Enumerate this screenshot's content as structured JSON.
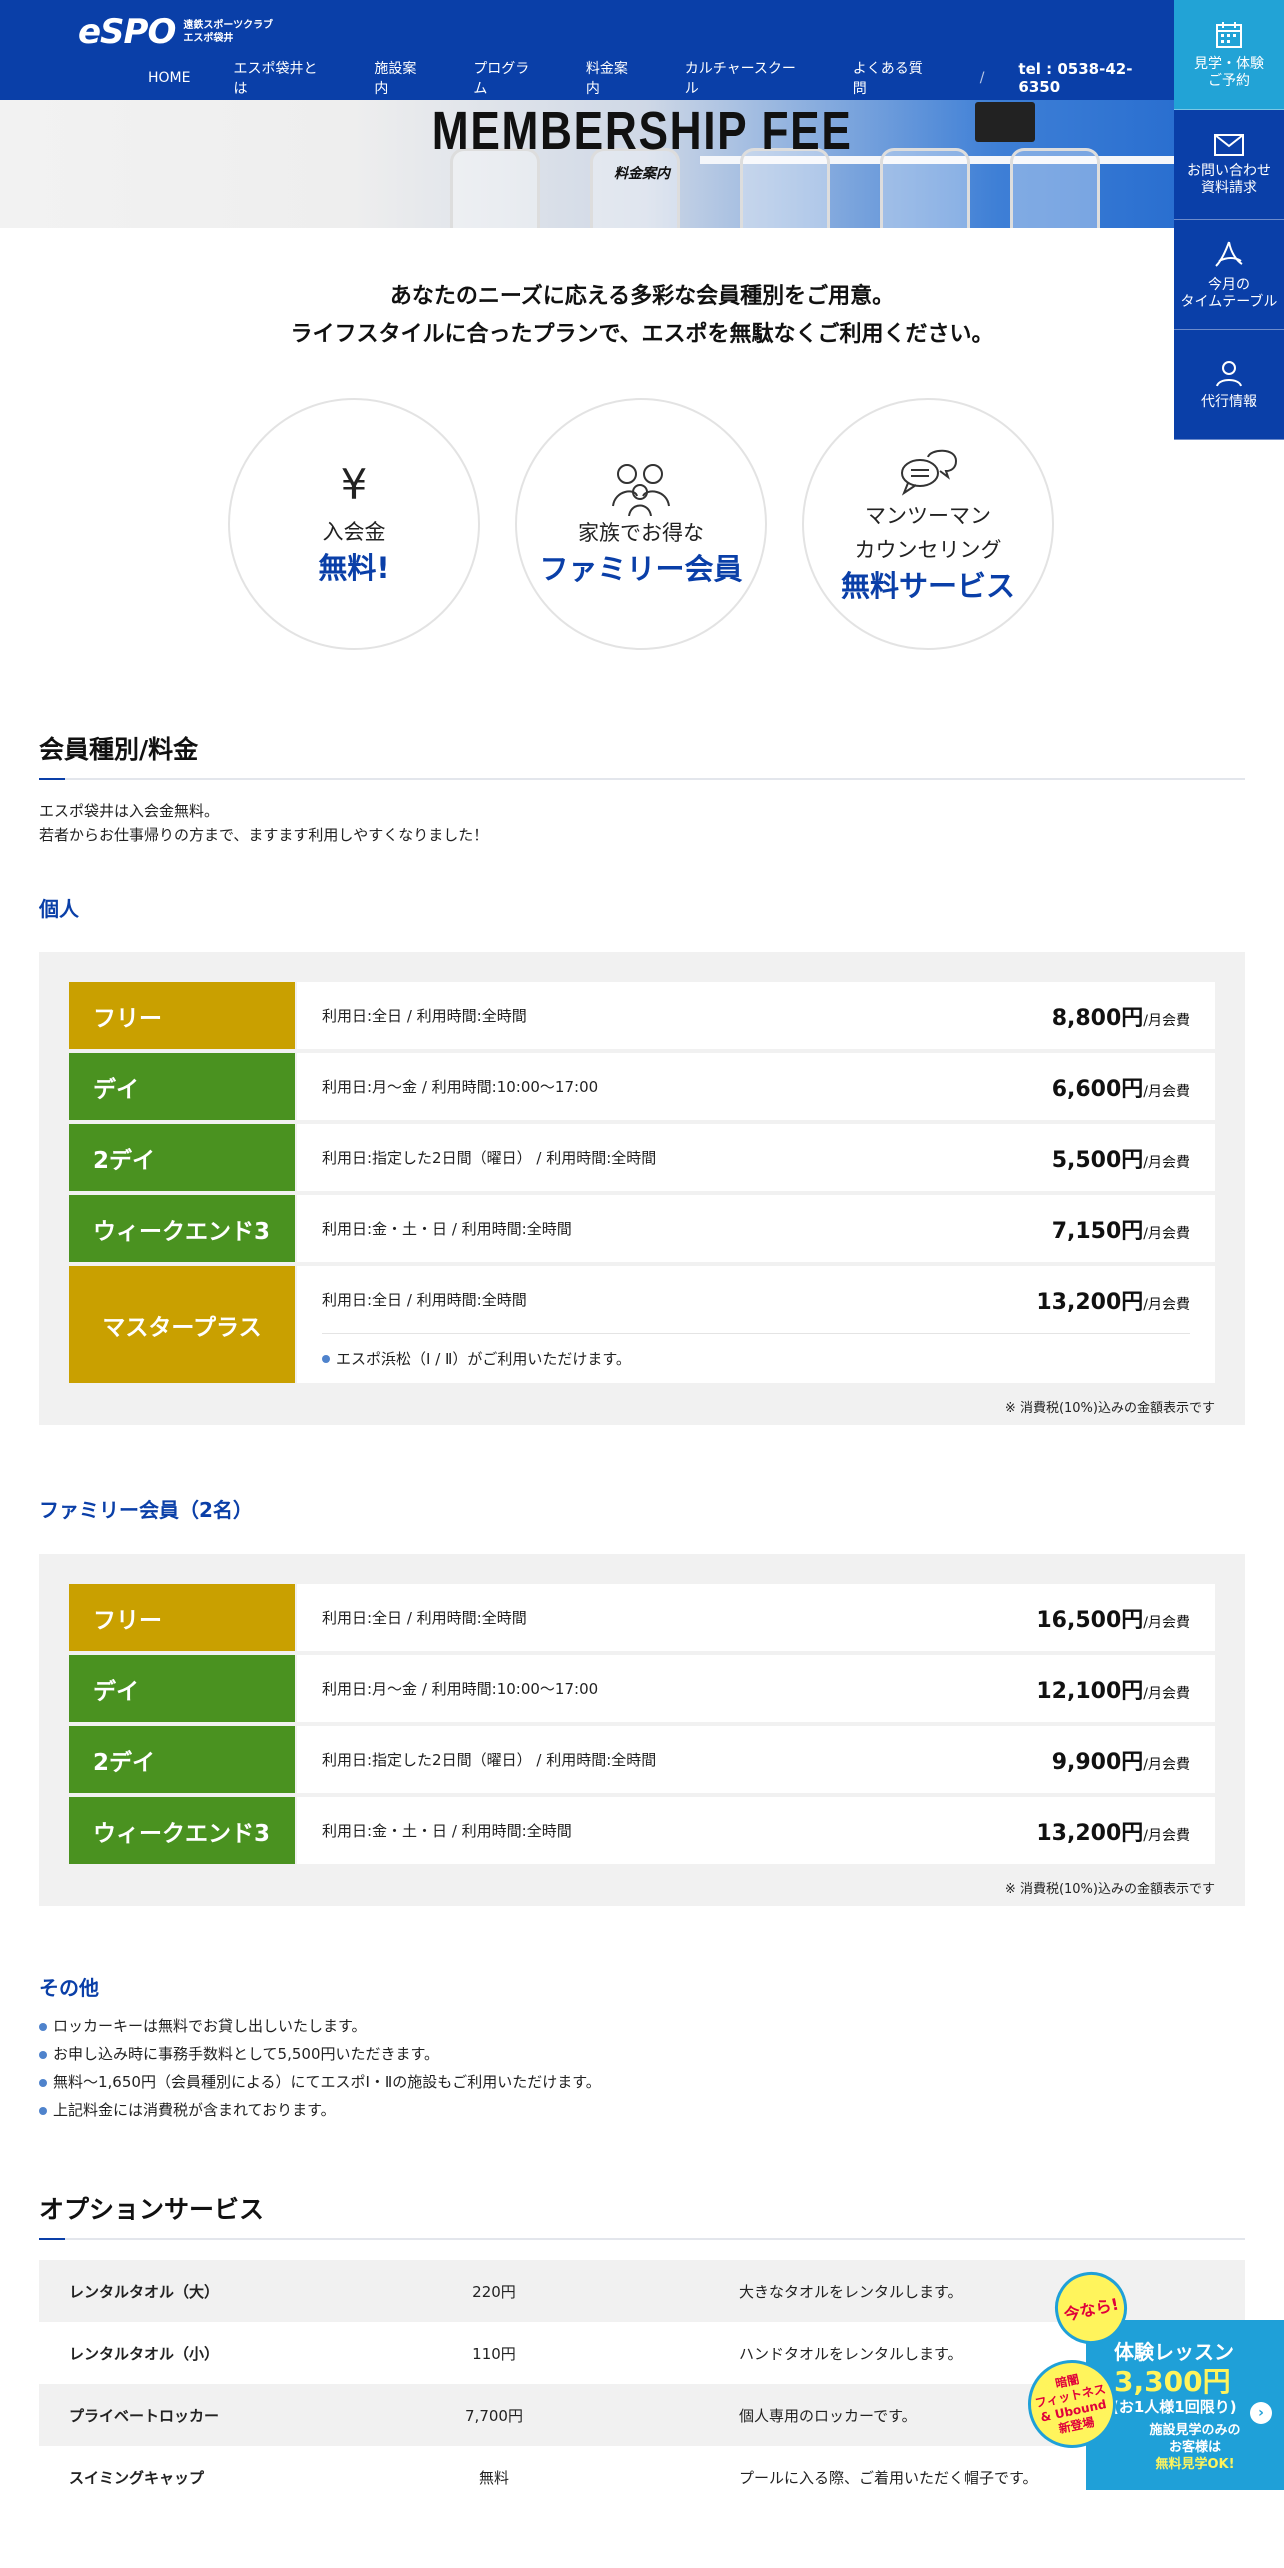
{
  "header": {
    "logo": "eSPO",
    "logo_sub1": "遠鉄スポーツクラブ",
    "logo_sub2": "エスポ袋井",
    "nav": [
      "HOME",
      "エスポ袋井とは",
      "施設案内",
      "プログラム",
      "料金案内",
      "カルチャースクール",
      "よくある質問"
    ],
    "slash": "/",
    "tel": "tel : 0538-42-6350"
  },
  "side": [
    {
      "label1": "見学・体験",
      "label2": "ご予約",
      "icon": "calendar-icon"
    },
    {
      "label1": "お問い合わせ",
      "label2": "資料請求",
      "icon": "mail-icon"
    },
    {
      "label1": "今月の",
      "label2": "タイムテーブル",
      "icon": "pdf-icon"
    },
    {
      "label1": "代行情報",
      "label2": "",
      "icon": "person-icon"
    }
  ],
  "hero": {
    "title": "MEMBERSHIP FEE",
    "subtitle": "料金案内"
  },
  "intro": {
    "line1": "あなたのニーズに応える多彩な会員種別をご用意。",
    "line2": "ライフスタイルに合ったプランで、エスポを無駄なくご利用ください。"
  },
  "features": [
    {
      "icon": "yen-icon",
      "glyph": "¥",
      "normal": "入会金",
      "big": "無料!"
    },
    {
      "icon": "family-icon",
      "normal": "家族でお得な",
      "big": "ファミリー会員"
    },
    {
      "icon": "chat-icon",
      "normal1": "マンツーマン",
      "normal2": "カウンセリング",
      "big": "無料サービス"
    }
  ],
  "membership": {
    "heading": "会員種別/料金",
    "lead1": "エスポ袋井は入会金無料。",
    "lead2": "若者からお仕事帰りの方まで、ますます利用しやすくなりました！",
    "unit": "/月会費",
    "tax_note": "※ 消費税(10%)込みの金額表示です",
    "individual_heading": "個人",
    "individual": [
      {
        "name": "フリー",
        "color": "#c9a000",
        "desc": "利用日:全日 / 利用時間:全時間",
        "price": "8,800円"
      },
      {
        "name": "デイ",
        "color": "#4a9220",
        "desc": "利用日:月～金 / 利用時間:10:00～17:00",
        "price": "6,600円"
      },
      {
        "name": "2デイ",
        "color": "#4a9220",
        "desc": "利用日:指定した2日間（曜日） / 利用時間:全時間",
        "price": "5,500円"
      },
      {
        "name": "ウィークエンド3",
        "color": "#4a9220",
        "desc": "利用日:金・土・日 / 利用時間:全時間",
        "price": "7,150円"
      },
      {
        "name": "マスタープラス",
        "color": "#c9a000",
        "desc": "利用日:全日 / 利用時間:全時間",
        "price": "13,200円",
        "note": "エスポ浜松（Ⅰ / Ⅱ）がご利用いただけます。"
      }
    ],
    "family_heading": "ファミリー会員（2名）",
    "family": [
      {
        "name": "フリー",
        "color": "#c9a000",
        "desc": "利用日:全日 / 利用時間:全時間",
        "price": "16,500円"
      },
      {
        "name": "デイ",
        "color": "#4a9220",
        "desc": "利用日:月～金 / 利用時間:10:00～17:00",
        "price": "12,100円"
      },
      {
        "name": "2デイ",
        "color": "#4a9220",
        "desc": "利用日:指定した2日間（曜日） / 利用時間:全時間",
        "price": "9,900円"
      },
      {
        "name": "ウィークエンド3",
        "color": "#4a9220",
        "desc": "利用日:金・土・日 / 利用時間:全時間",
        "price": "13,200円"
      }
    ]
  },
  "others": {
    "heading": "その他",
    "items": [
      "ロッカーキーは無料でお貸し出しいたします。",
      "お申し込み時に事務手数料として5,500円いただきます。",
      "無料～1,650円（会員種別による）にてエスポⅠ・Ⅱの施設もご利用いただけます。",
      "上記料金には消費税が含まれております。"
    ]
  },
  "options": {
    "heading": "オプションサービス",
    "rows": [
      {
        "name": "レンタルタオル（大）",
        "price": "220円",
        "desc": "大きなタオルをレンタルします。"
      },
      {
        "name": "レンタルタオル（小）",
        "price": "110円",
        "desc": "ハンドタオルをレンタルします。"
      },
      {
        "name": "プライベートロッカー",
        "price": "7,700円",
        "desc": "個人専用のロッカーです。"
      },
      {
        "name": "スイミングキャップ",
        "price": "無料",
        "desc": "プールに入る際、ご着用いただく帽子です。"
      }
    ]
  },
  "trial": {
    "badge_now": "今なら!",
    "badge_line1": "暗闇",
    "badge_line2": "フィットネス",
    "badge_line3": "& Ubound",
    "badge_line4": "新登場",
    "title": "体験レッスン",
    "price": "3,300円",
    "cond": "(お1人様1回限り)",
    "note1": "施設見学のみの",
    "note2": "お客様は",
    "note3": "無料見学OK!",
    "arrow": "›"
  }
}
